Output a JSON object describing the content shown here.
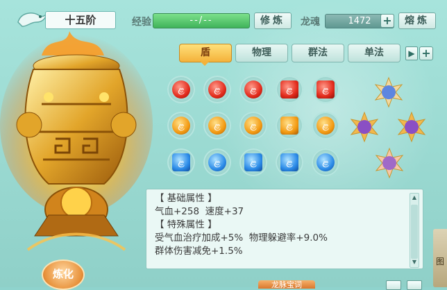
{
  "header": {
    "tier": "十五阶",
    "exp_label": "经验",
    "exp_value": "--/--",
    "cultivate_button": "修炼",
    "soul_label": "龙魂",
    "soul_value": "1472",
    "smelt_button": "熔炼"
  },
  "tabs": [
    {
      "label": "盾",
      "active": true
    },
    {
      "label": "物理",
      "active": false
    },
    {
      "label": "群法",
      "active": false
    },
    {
      "label": "单法",
      "active": false
    }
  ],
  "gems": {
    "rows": [
      {
        "color": "red",
        "shapes": [
          "round",
          "round",
          "round",
          "square",
          "square"
        ]
      },
      {
        "color": "orange",
        "shapes": [
          "round",
          "round",
          "round",
          "square",
          "round"
        ]
      },
      {
        "color": "blue",
        "shapes": [
          "square",
          "round",
          "square",
          "square",
          "round"
        ]
      }
    ],
    "glyph": "ළ"
  },
  "info": {
    "base_header": "【 基础属性 】",
    "base_stats": "气血+258  速度+37",
    "special_header": "【 特殊属性 】",
    "special_line1": "受气血治疗加成+5%  物理躲避率+9.0%",
    "special_line2": "群体伤害减免+1.5%"
  },
  "refine_button": "炼化",
  "bottom_button": "龙脉宝词",
  "side_widget_label": "图"
}
